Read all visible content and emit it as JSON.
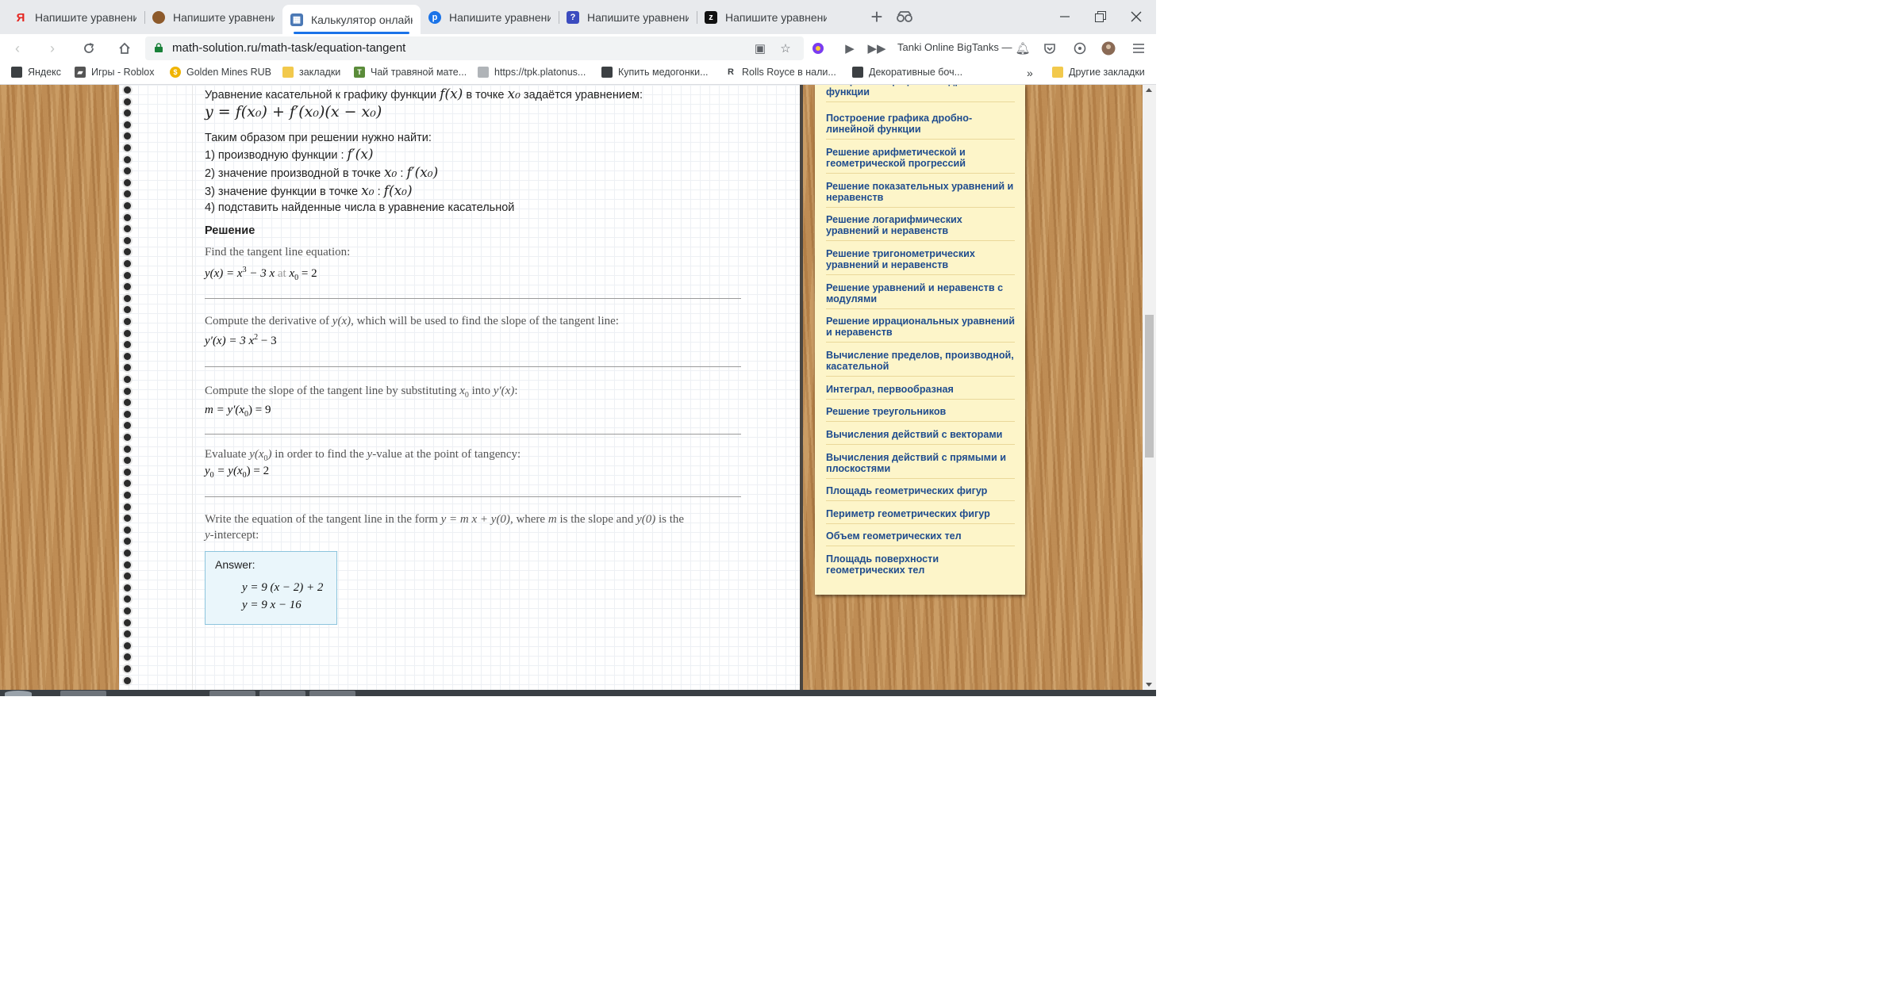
{
  "browser": {
    "tabs": [
      {
        "label": "Напишите уравнение",
        "favicon": "yandex-icon",
        "color": "#e52620"
      },
      {
        "label": "Напишите уравнение",
        "favicon": "coffee-icon",
        "color": "#8d5a2b"
      },
      {
        "label": "Калькулятор онлайн",
        "favicon": "calculator-icon",
        "color": "#4a78b5",
        "active": true
      },
      {
        "label": "Напишите уравнение",
        "favicon": "circle-p-icon",
        "color": "#1a73e8"
      },
      {
        "label": "Напишите уравнение",
        "favicon": "box-question-icon",
        "color": "#3b4bbf"
      },
      {
        "label": "Напишите уравнение",
        "favicon": "black-z-icon",
        "color": "#111111"
      }
    ],
    "new_tab_icon": "plus-icon",
    "window_controls": [
      "minimize-icon",
      "restore-icon",
      "close-icon"
    ],
    "address": {
      "url": "math-solution.ru/math-task/equation-tangent",
      "secure_color": "#188038"
    },
    "extension_text": "Tanki Online BigTanks —",
    "bookmarks": [
      {
        "label": "Яндекс",
        "icon": "page-icon"
      },
      {
        "label": "Игры - Roblox",
        "icon": "roblox-icon"
      },
      {
        "label": "Golden Mines RUB",
        "icon": "coin-icon"
      },
      {
        "label": "закладки",
        "icon": "folder-icon"
      },
      {
        "label": "Чай травяной мате...",
        "icon": "tea-icon"
      },
      {
        "label": "https://tpk.platonus...",
        "icon": "page-icon"
      },
      {
        "label": "Купить медогонки...",
        "icon": "page-icon"
      },
      {
        "label": "Rolls Royce в нали...",
        "icon": "rolls-icon"
      },
      {
        "label": "Декоративные боч...",
        "icon": "page-icon"
      }
    ],
    "bookmarks_more": "»",
    "other_bookmarks": "Другие закладки"
  },
  "page": {
    "theory": {
      "line1_text": "Уравнение касательной к графику функции",
      "line1_fx": "f(x)",
      "line1_mid": "в точке",
      "line1_x0": "x₀",
      "line1_end": "задаётся уравнением:",
      "formula": "y = f(x₀) + f′(x₀)(x − x₀)",
      "need_title": "Таким образом при решении нужно найти:",
      "item1_text": "1) производную функции :",
      "item1_math": "f′(x)",
      "item2_text": "2) значение производной в точке",
      "item2_x0": "x₀",
      "item2_sep": ":",
      "item2_math": "f′(x₀)",
      "item3_text": "3) значение функции в точке",
      "item3_x0": "x₀",
      "item3_sep": ":",
      "item3_math": "f(x₀)",
      "item4_text": "4) подставить найденные числа в уравнение касательной"
    },
    "solution_title": "Решение",
    "steps": {
      "s1_intro": "Find the tangent line equation:",
      "s1_lhs": "y(x) = x",
      "s1_pow": "3",
      "s1_rest": " − 3 x",
      "s1_at": " at ",
      "s1_x0": "x",
      "s1_x0sub": "0",
      "s1_val": " = 2",
      "s2_intro_a": "Compute the derivative of ",
      "s2_intro_var": "y(x)",
      "s2_intro_b": ", which will be used to find the slope of the tangent line:",
      "s2_lhs": "y′(x) = 3 x",
      "s2_pow": "2",
      "s2_rest": " − 3",
      "s3_intro_a": "Compute the slope of the tangent line by substituting ",
      "s3_x": "x",
      "s3_xsub": "0",
      "s3_intro_b": " into ",
      "s3_var": "y′(x)",
      "s3_intro_c": ":",
      "s3_formula_a": "m = y′(x",
      "s3_formula_sub": "0",
      "s3_formula_b": ") = 9",
      "s4_intro_a": "Evaluate ",
      "s4_var_a": "y(x",
      "s4_var_sub": "0",
      "s4_var_b": ")",
      "s4_intro_b": " in order to find the ",
      "s4_var_y": "y",
      "s4_intro_c": "-value at the point of tangency:",
      "s4_formula_a": "y",
      "s4_formula_sub1": "0",
      "s4_formula_b": " = y(x",
      "s4_formula_sub2": "0",
      "s4_formula_c": ") = 2",
      "s5_intro_a": "Write the equation of the tangent line in the form ",
      "s5_form": "y = m x + y(0)",
      "s5_intro_b": ", where ",
      "s5_m": "m",
      "s5_intro_c": " is the slope and ",
      "s5_y0": "y(0)",
      "s5_intro_d": " is the",
      "s5_line2_var": "y",
      "s5_line2": "-intercept:"
    },
    "answer": {
      "label": "Answer:",
      "line1": "y = 9 (x − 2) + 2",
      "line2": "y = 9 x − 16"
    },
    "sidebar_links": [
      "Построение графика квадратичной функции",
      "Построение графика дробно-линейной функции",
      "Решение арифметической и геометрической прогрессий",
      "Решение показательных уравнений и неравенств",
      "Решение логарифмических уравнений и неравенств",
      "Решение тригонометрических уравнений и неравенств",
      "Решение уравнений и неравенств с модулями",
      "Решение иррациональных уравнений и неравенств",
      "Вычисление пределов, производной, касательной",
      "Интеграл, первообразная",
      "Решение треугольников",
      "Вычисления действий с векторами",
      "Вычисления действий с прямыми и плоскостями",
      "Площадь геометрических фигур",
      "Периметр геометрических фигур",
      "Объем геометрических тел",
      "Площадь поверхности геометрических тел"
    ],
    "colors": {
      "link": "#1f4c8e",
      "sidebar_bg": "#fdf5c9",
      "answer_bg": "#eaf6fb",
      "wood": "#c08c52"
    }
  }
}
